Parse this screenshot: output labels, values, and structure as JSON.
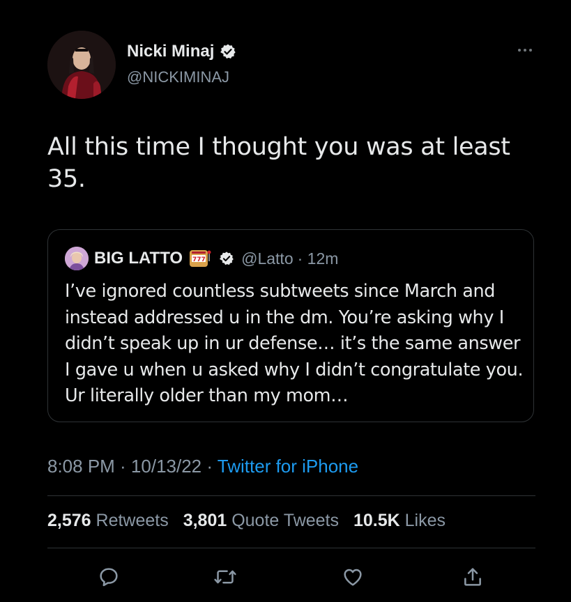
{
  "tweet": {
    "author": {
      "name": "Nicki Minaj",
      "handle": "@NICKIMINAJ",
      "verified": true
    },
    "text": "All this time I thought you was at least 35.",
    "timestamp": "8:08 PM · 10/13/22 · ",
    "source": "Twitter for iPhone"
  },
  "quoted": {
    "name": "BIG LATTO",
    "handle": "@Latto",
    "time": "· 12m",
    "text": "I’ve ignored countless subtweets since March and instead addressed u in the dm. You’re asking why I didn’t speak up in ur defense… it’s the same answer I gave u when u asked why I didn’t congratulate you. Ur literally older than my mom…"
  },
  "stats": {
    "retweets_count": "2,576",
    "retweets_label": "Retweets",
    "quotes_count": "3,801",
    "quotes_label": "Quote Tweets",
    "likes_count": "10.5K",
    "likes_label": "Likes"
  },
  "icons": {
    "reply": "reply-icon",
    "retweet": "retweet-icon",
    "like": "heart-icon",
    "share": "share-icon",
    "more": "more-icon",
    "verified": "verified-badge-icon",
    "slot_machine": "slot-machine-emoji"
  },
  "colors": {
    "background": "#000000",
    "text": "#e7e9ea",
    "secondary": "#8b98a5",
    "link": "#1d9bf0",
    "border": "#2f3336"
  }
}
